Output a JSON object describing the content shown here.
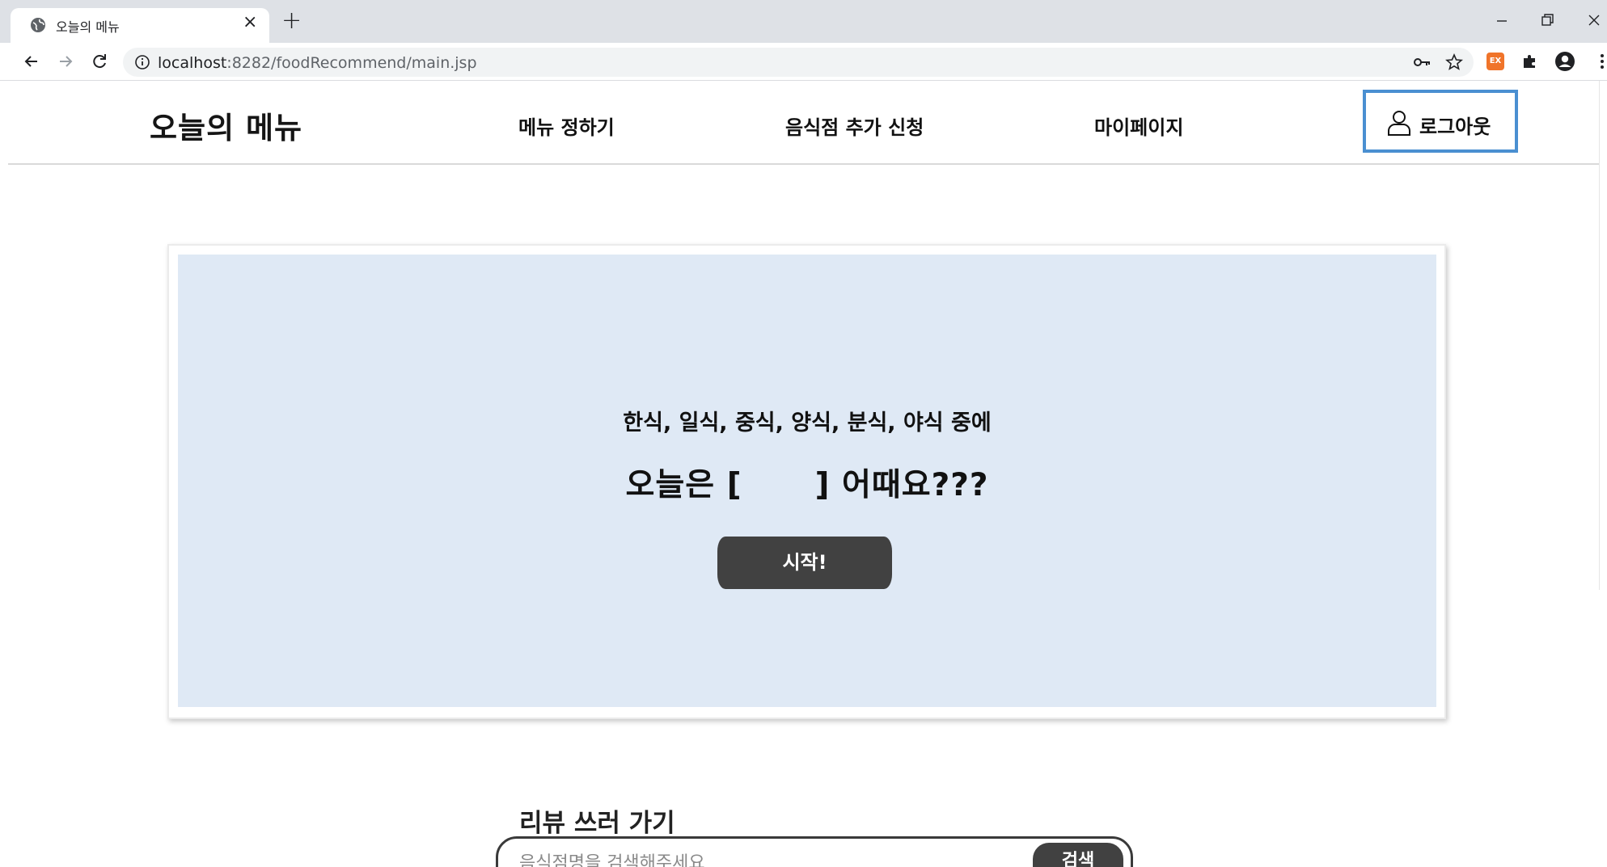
{
  "browser": {
    "tab_title": "오늘의 메뉴",
    "tab_close": "×",
    "new_tab": "+",
    "url_host": "localhost",
    "url_path": ":8282/foodRecommend/main.jsp",
    "extension_badge": "EX"
  },
  "header": {
    "logo": "오늘의 메뉴",
    "nav": {
      "menu": "메뉴 정하기",
      "apply": "음식점 추가 신청",
      "mypage": "마이페이지"
    },
    "logout_label": "로그아웃"
  },
  "hero": {
    "subtitle": "한식, 일식, 중식, 양식, 분식, 야식 중에",
    "main_prefix": "오늘은 [",
    "main_suffix": "] 어때요???",
    "start_label": "시작!"
  },
  "review": {
    "title": "리뷰 쓰러 가기",
    "search_placeholder": "음식점명을 검색해주세요",
    "search_button": "검색"
  },
  "colors": {
    "hero_bg": "#dfe9f5",
    "button_dark": "#414141",
    "logout_border": "#4a8fd1"
  }
}
